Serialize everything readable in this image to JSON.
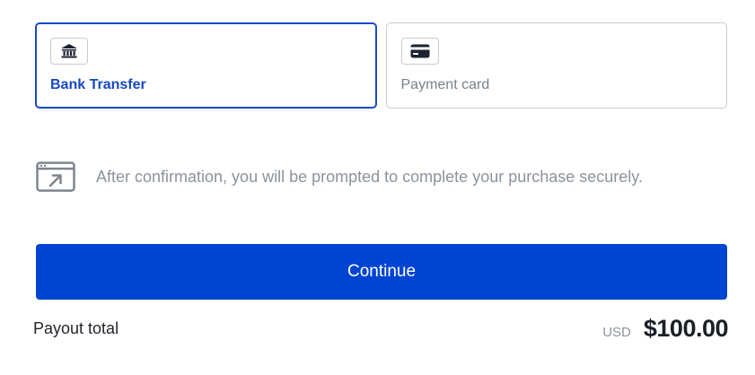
{
  "payment_methods": [
    {
      "label": "Bank Transfer",
      "icon": "bank-icon",
      "selected": true
    },
    {
      "label": "Payment card",
      "icon": "credit-card-icon",
      "selected": false
    }
  ],
  "notice": {
    "icon": "external-window-icon",
    "text": "After confirmation, you will be prompted to complete your purchase securely."
  },
  "continue_button": {
    "label": "Continue"
  },
  "totals": {
    "label": "Payout total",
    "currency": "USD",
    "amount": "$100.00"
  },
  "colors": {
    "accent": "#0044d2",
    "selected_text": "#1748c3",
    "muted_text": "#8d939b",
    "border": "#c7cbd1"
  }
}
